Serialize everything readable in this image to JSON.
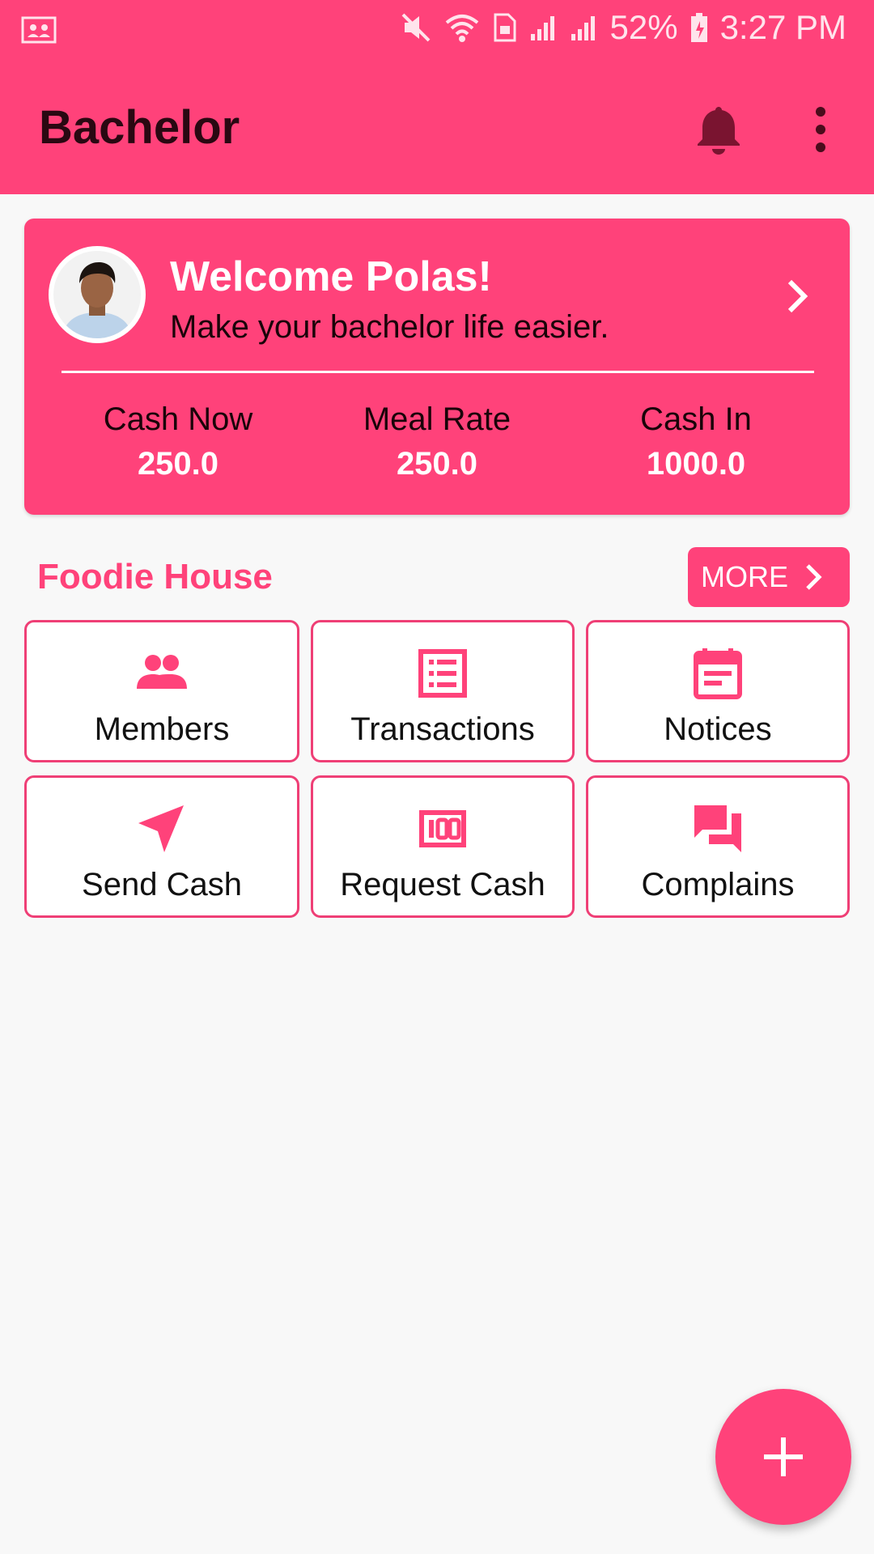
{
  "status_bar": {
    "battery": "52%",
    "time": "3:27 PM"
  },
  "app_bar": {
    "title": "Bachelor",
    "icons": [
      "notifications-icon",
      "overflow-menu-icon"
    ]
  },
  "welcome_card": {
    "title": "Welcome Polas!",
    "subtitle": "Make your bachelor life easier.",
    "stats": [
      {
        "label": "Cash Now",
        "value": "250.0"
      },
      {
        "label": "Meal Rate",
        "value": "250.0"
      },
      {
        "label": "Cash In",
        "value": "1000.0"
      }
    ]
  },
  "section": {
    "title": "Foodie House",
    "more_label": "MORE"
  },
  "tiles": [
    {
      "label": "Members",
      "icon": "people-icon"
    },
    {
      "label": "Transactions",
      "icon": "list-icon"
    },
    {
      "label": "Notices",
      "icon": "calendar-note-icon"
    },
    {
      "label": "Send Cash",
      "icon": "send-icon"
    },
    {
      "label": "Request Cash",
      "icon": "cash-icon"
    },
    {
      "label": "Complains",
      "icon": "chat-icon"
    }
  ],
  "fab": {
    "icon": "plus-icon"
  },
  "colors": {
    "primary": "#ff427a",
    "tile_border": "#ef3f76",
    "dark_text": "#2a0812"
  }
}
